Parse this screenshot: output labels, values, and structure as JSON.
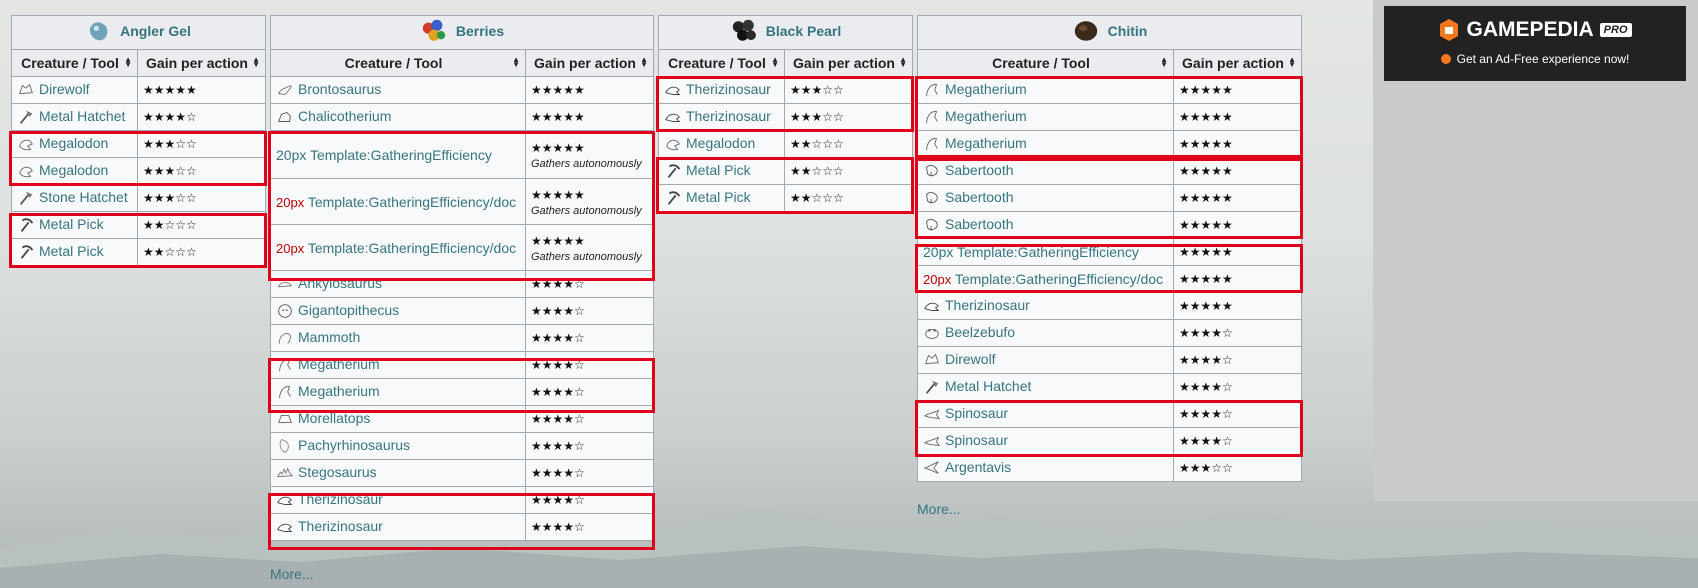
{
  "headers": {
    "creature": "Creature / Tool",
    "gain": "Gain per action"
  },
  "tables": [
    {
      "title": "Angler Gel",
      "rows": [
        {
          "name": "Direwolf",
          "stars": "★★★★★"
        },
        {
          "name": "Metal Hatchet",
          "stars": "★★★★☆"
        },
        {
          "name": "Megalodon",
          "stars": "★★★☆☆"
        },
        {
          "name": "Megalodon",
          "stars": "★★★☆☆"
        },
        {
          "name": "Stone Hatchet",
          "stars": "★★★☆☆"
        },
        {
          "name": "Metal Pick",
          "stars": "★★☆☆☆"
        },
        {
          "name": "Metal Pick",
          "stars": "★★☆☆☆"
        }
      ]
    },
    {
      "title": "Berries",
      "rows": [
        {
          "name": "Brontosaurus",
          "stars": "★★★★★"
        },
        {
          "name": "Chalicotherium",
          "stars": "★★★★★"
        },
        {
          "prefix": "20px",
          "name": "Template:GatheringEfficiency",
          "stars": "★★★★★",
          "note": "Gathers autonomously"
        },
        {
          "prefix": "20px",
          "name": "Template:GatheringEfficiency/doc",
          "stars": "★★★★★",
          "note": "Gathers autonomously"
        },
        {
          "prefix": "20px",
          "name": "Template:GatheringEfficiency/doc",
          "stars": "★★★★★",
          "note": "Gathers autonomously"
        },
        {
          "name": "Ankylosaurus",
          "stars": "★★★★☆"
        },
        {
          "name": "Gigantopithecus",
          "stars": "★★★★☆"
        },
        {
          "name": "Mammoth",
          "stars": "★★★★☆"
        },
        {
          "name": "Megatherium",
          "stars": "★★★★☆"
        },
        {
          "name": "Megatherium",
          "stars": "★★★★☆"
        },
        {
          "name": "Morellatops",
          "stars": "★★★★☆"
        },
        {
          "name": "Pachyrhinosaurus",
          "stars": "★★★★☆"
        },
        {
          "name": "Stegosaurus",
          "stars": "★★★★☆"
        },
        {
          "name": "Therizinosaur",
          "stars": "★★★★☆"
        },
        {
          "name": "Therizinosaur",
          "stars": "★★★★☆"
        }
      ],
      "more": "More..."
    },
    {
      "title": "Black Pearl",
      "rows": [
        {
          "name": "Therizinosaur",
          "stars": "★★★☆☆"
        },
        {
          "name": "Therizinosaur",
          "stars": "★★★☆☆"
        },
        {
          "name": "Megalodon",
          "stars": "★★☆☆☆"
        },
        {
          "name": "Metal Pick",
          "stars": "★★☆☆☆"
        },
        {
          "name": "Metal Pick",
          "stars": "★★☆☆☆"
        }
      ]
    },
    {
      "title": "Chitin",
      "rows": [
        {
          "name": "Megatherium",
          "stars": "★★★★★"
        },
        {
          "name": "Megatherium",
          "stars": "★★★★★"
        },
        {
          "name": "Megatherium",
          "stars": "★★★★★"
        },
        {
          "name": "Sabertooth",
          "stars": "★★★★★"
        },
        {
          "name": "Sabertooth",
          "stars": "★★★★★"
        },
        {
          "name": "Sabertooth",
          "stars": "★★★★★"
        },
        {
          "prefix": "20px",
          "name": "Template:GatheringEfficiency",
          "stars": "★★★★★"
        },
        {
          "prefix": "20px",
          "name": "Template:GatheringEfficiency/doc",
          "stars": "★★★★★"
        },
        {
          "name": "Therizinosaur",
          "stars": "★★★★★"
        },
        {
          "name": "Beelzebufo",
          "stars": "★★★★☆"
        },
        {
          "name": "Direwolf",
          "stars": "★★★★☆"
        },
        {
          "name": "Metal Hatchet",
          "stars": "★★★★☆"
        },
        {
          "name": "Spinosaur",
          "stars": "★★★★☆"
        },
        {
          "name": "Spinosaur",
          "stars": "★★★★☆"
        },
        {
          "name": "Argentavis",
          "stars": "★★★☆☆"
        }
      ],
      "more": "More..."
    }
  ],
  "ad": {
    "brand": "GAMEPEDIA",
    "badge": "PRO",
    "tagline": "Get an Ad-Free experience now!"
  }
}
